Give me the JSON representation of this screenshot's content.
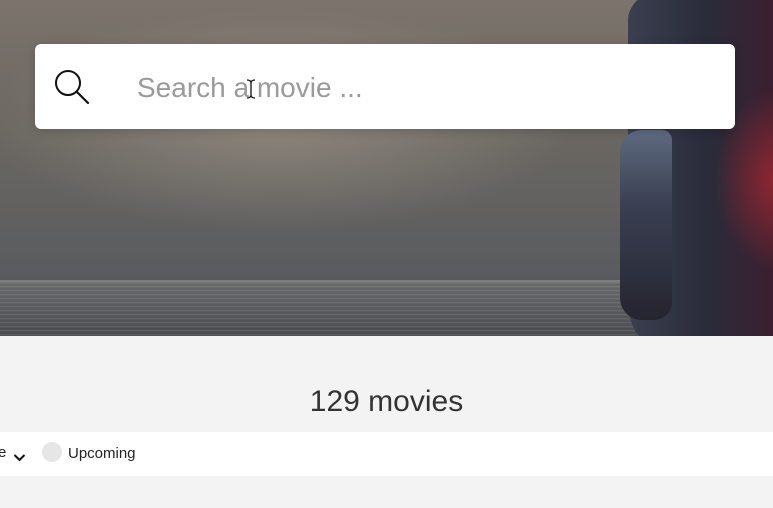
{
  "search": {
    "placeholder": "Search a movie ...",
    "icon": "search-icon",
    "cursor_icon": "text-cursor-icon"
  },
  "results": {
    "count_text": "129 movies"
  },
  "filters": {
    "partial_dropdown_text": "e",
    "dropdown_icon": "chevron-down-icon",
    "upcoming_label": "Upcoming",
    "upcoming_checked": false
  },
  "colors": {
    "page_background": "#f3f3f3",
    "search_box": "#ffffff",
    "text": "#333333",
    "toggle_off": "#e6e6e6"
  }
}
